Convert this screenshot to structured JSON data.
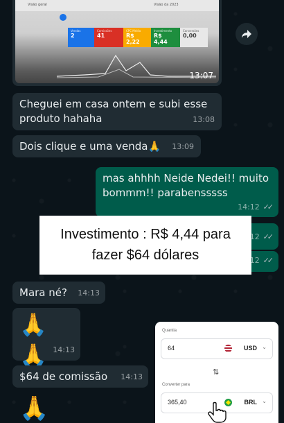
{
  "shared_image": {
    "dashboard_title": "Visão geral",
    "date_filter": "Visão da 2023",
    "kpis": [
      {
        "label": "Vendas",
        "value": "2",
        "color": "#1a73e8"
      },
      {
        "label": "Comissões",
        "value": "41",
        "color": "#d93025"
      },
      {
        "label": "CPC Médio",
        "value": "R$ 2,22",
        "color": "#f9ab00"
      },
      {
        "label": "Investimento",
        "value": "R$ 4,44",
        "color": "#1e8e3e"
      },
      {
        "label": "Conversões",
        "value": "0,00",
        "color": "#e8e8e8"
      }
    ],
    "time": "13:07"
  },
  "messages": [
    {
      "text": "Cheguei em casa ontem e subi esse produto hahaha",
      "time": "13:08"
    },
    {
      "text": "Dois clique e uma venda🙏",
      "time": "13:09"
    },
    {
      "text": "mas ahhhh Neide Nedei!! muito bommm!! parabensssss",
      "time": "14:12"
    },
    {
      "time": "14:12"
    },
    {
      "time": "14:12"
    },
    {
      "text": "Mara né?",
      "time": "14:13"
    },
    {
      "text": "🙏🙏",
      "time": "14:13"
    },
    {
      "text": "$64 de comissão",
      "time": "14:13"
    },
    {
      "text": "🙏"
    }
  ],
  "overlay_caption": {
    "line1": "Investimento : R$ 4,44 para",
    "line2": "fazer $64 dólares"
  },
  "converter": {
    "amount_label": "Quantia",
    "amount_value": "64",
    "from_currency": "USD",
    "convert_label": "Converter para",
    "result_value": "365,40",
    "to_currency": "BRL",
    "swap_symbol": "⇅"
  },
  "icons": {
    "forward": "forward-arrow-icon",
    "read_ticks": "double-check-icon",
    "cursor": "hand-pointer-icon"
  }
}
